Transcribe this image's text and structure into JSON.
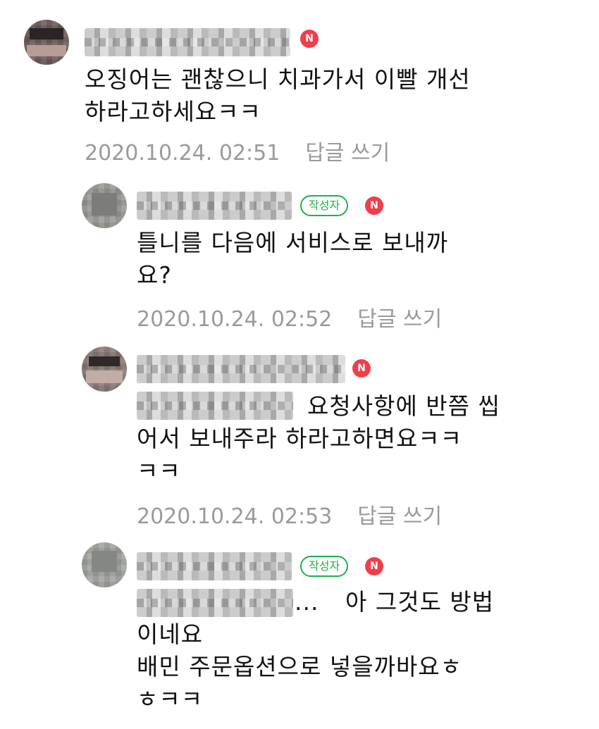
{
  "comments": [
    {
      "badge_author": "",
      "badge_new": "N",
      "prefix": "",
      "text": "오징어는 괜찮으니 치과가서 이빨 개선\n하라고하세요ㅋㅋ",
      "timestamp": "2020.10.24. 02:51",
      "reply_label": "답글 쓰기"
    },
    {
      "badge_author": "작성자",
      "badge_new": "N",
      "prefix": "",
      "text": "틀니를 다음에 서비스로 보내까\n요?",
      "timestamp": "2020.10.24. 02:52",
      "reply_label": "답글 쓰기"
    },
    {
      "badge_author": "",
      "badge_new": "N",
      "prefix": "",
      "text": "요청사항에 반쯤 씹",
      "text_cont": "어서 보내주라 하라고하면요ㅋㅋ\nㅋㅋ",
      "timestamp": "2020.10.24. 02:53",
      "reply_label": "답글 쓰기"
    },
    {
      "badge_author": "작성자",
      "badge_new": "N",
      "prefix": "...",
      "text": "아 그것도 방법",
      "text_cont": "이네요\n배민 주문옵션으로 넣을까바요ㅎ\nㅎㅋㅋ"
    }
  ]
}
